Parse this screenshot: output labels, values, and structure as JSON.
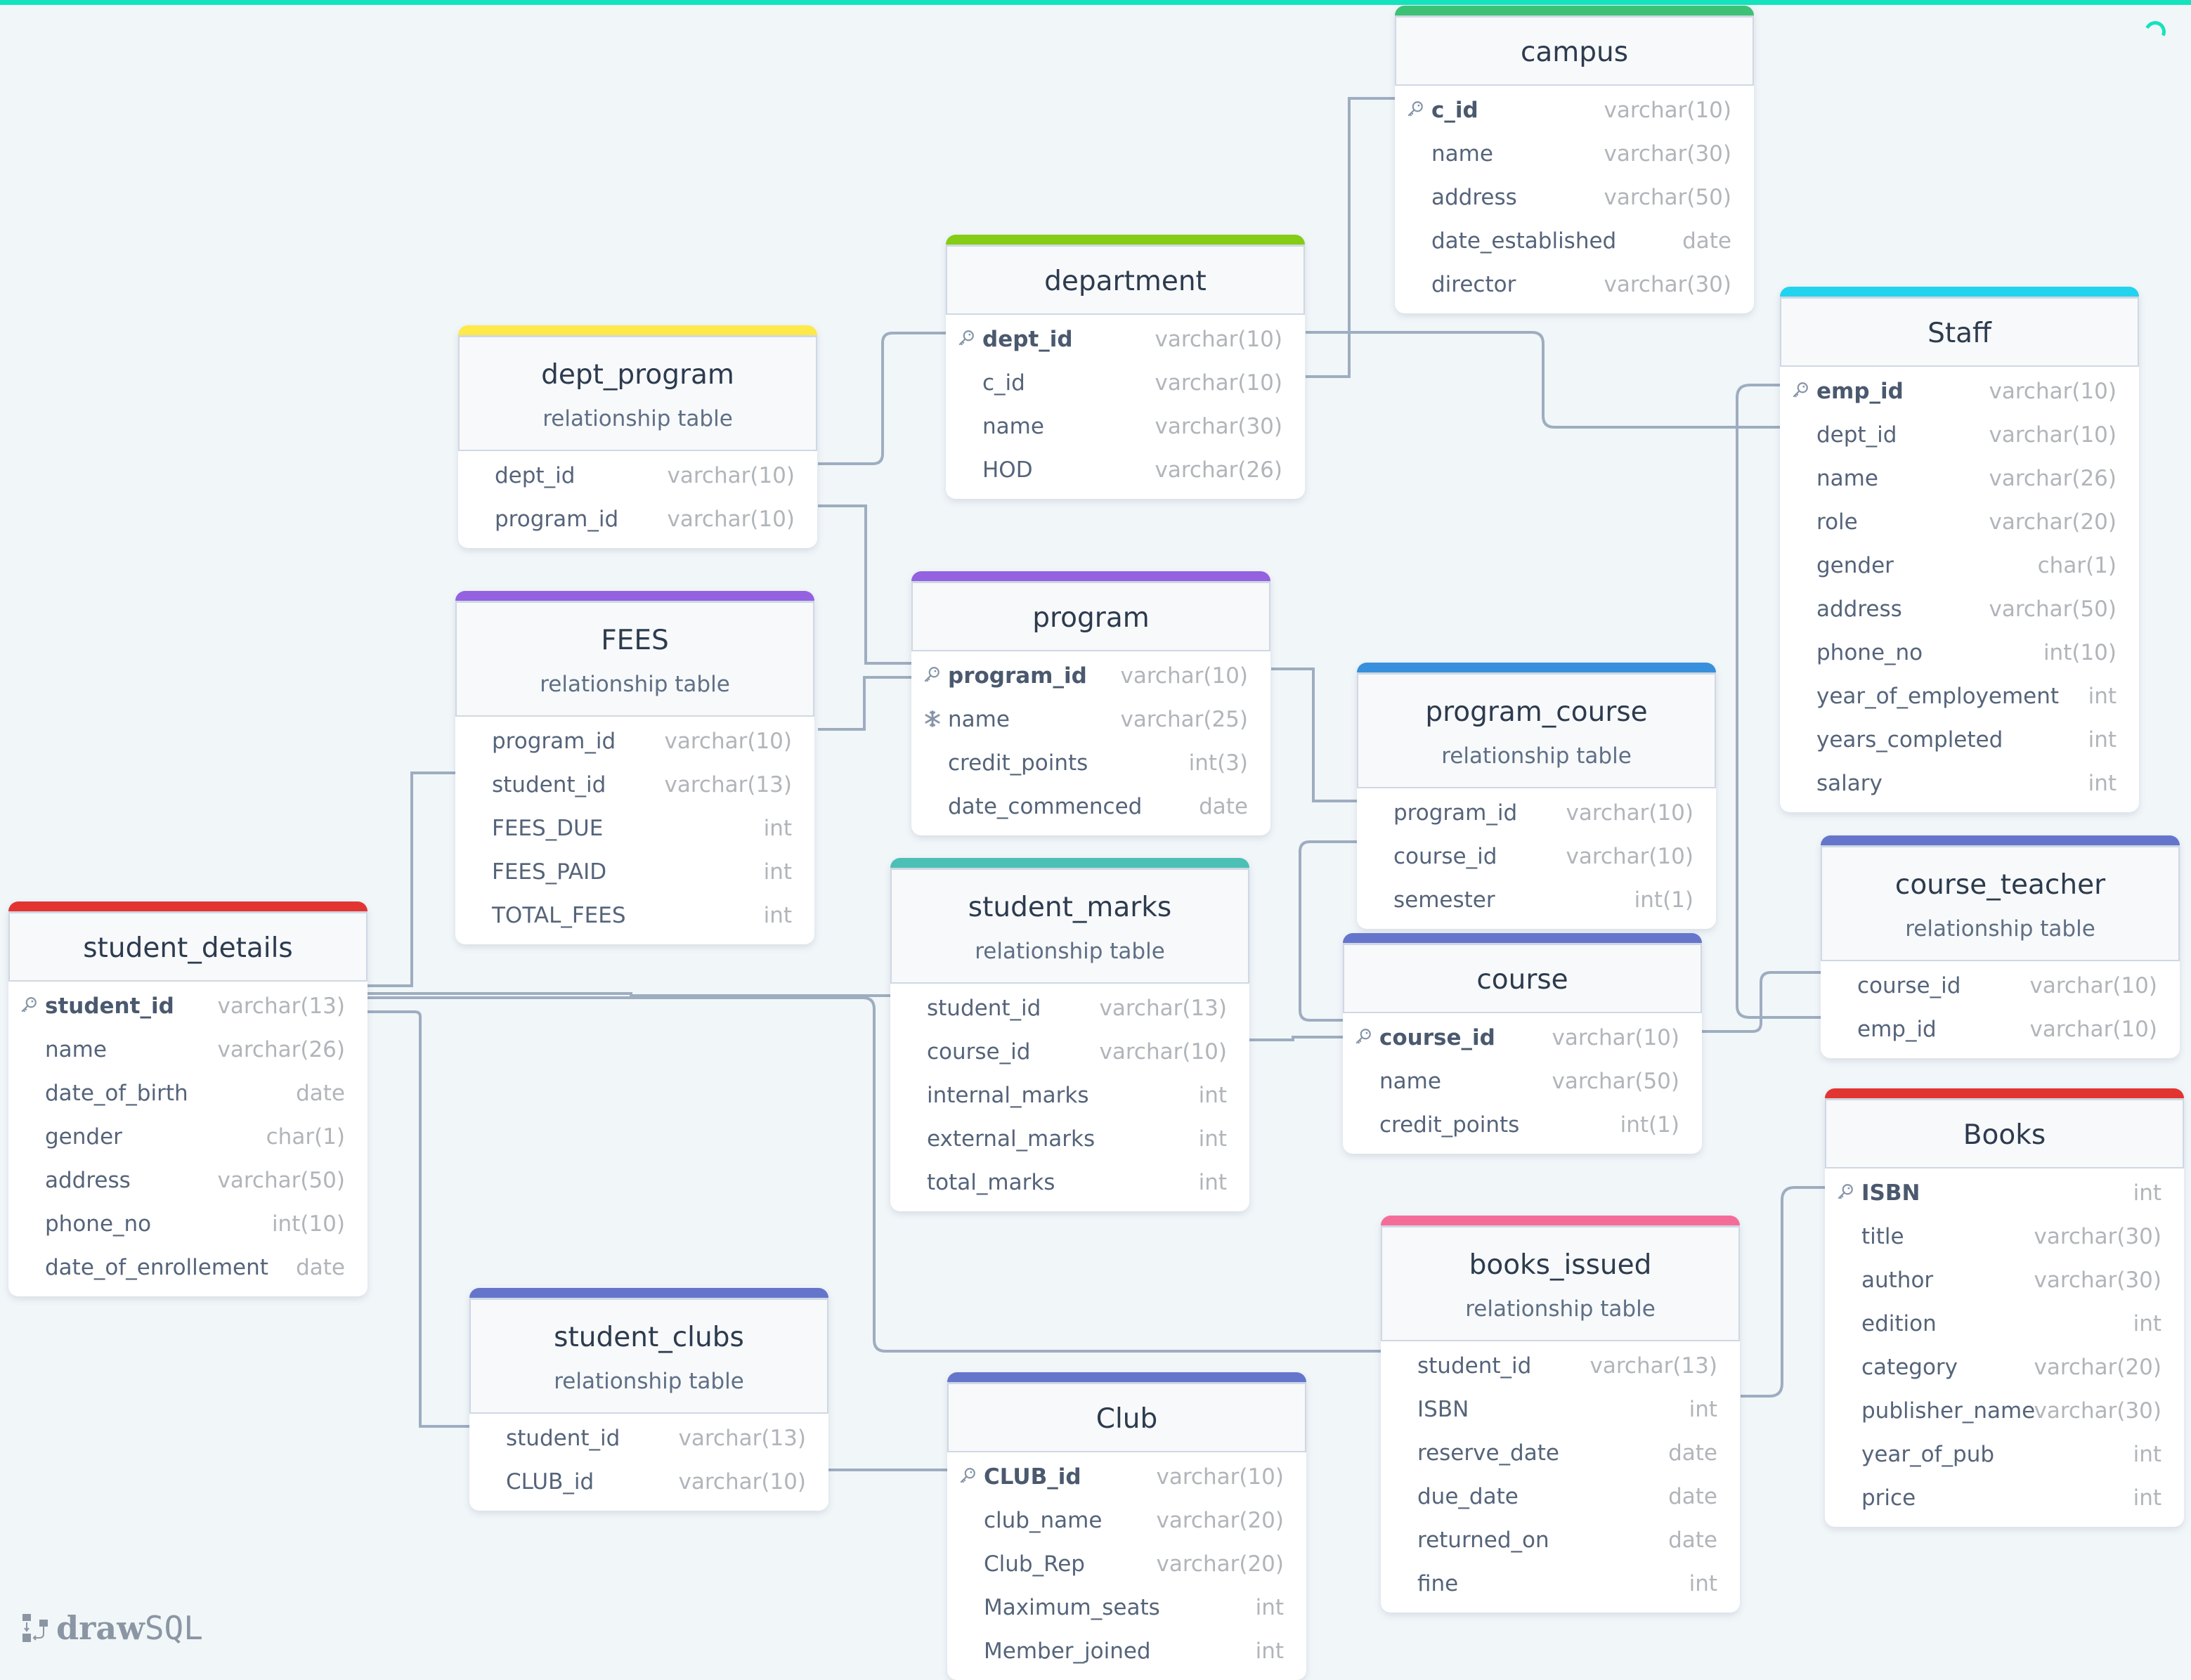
{
  "app": {
    "logo_text_bold": "draw",
    "logo_text_light": "SQL"
  },
  "colors": {
    "accent": "#14e3bd",
    "link": "#9eadc0"
  },
  "tables": {
    "campus": {
      "name": "campus",
      "color": "#3cc177",
      "fields": [
        {
          "name": "c_id",
          "type": "varchar(10)",
          "pk": true
        },
        {
          "name": "name",
          "type": "varchar(30)"
        },
        {
          "name": "address",
          "type": "varchar(50)"
        },
        {
          "name": "date_established",
          "type": "date"
        },
        {
          "name": "director",
          "type": "varchar(30)"
        }
      ]
    },
    "department": {
      "name": "department",
      "color": "#84cc16",
      "fields": [
        {
          "name": "dept_id",
          "type": "varchar(10)",
          "pk": true
        },
        {
          "name": "c_id",
          "type": "varchar(10)"
        },
        {
          "name": "name",
          "type": "varchar(30)"
        },
        {
          "name": "HOD",
          "type": "varchar(26)"
        }
      ]
    },
    "dept_program": {
      "name": "dept_program",
      "subtitle": "relationship table",
      "color": "#fde947",
      "fields": [
        {
          "name": "dept_id",
          "type": "varchar(10)"
        },
        {
          "name": "program_id",
          "type": "varchar(10)"
        }
      ]
    },
    "FEES": {
      "name": "FEES",
      "subtitle": "relationship table",
      "color": "#9461e0",
      "fields": [
        {
          "name": "program_id",
          "type": "varchar(10)"
        },
        {
          "name": "student_id",
          "type": "varchar(13)"
        },
        {
          "name": "FEES_DUE",
          "type": "int"
        },
        {
          "name": "FEES_PAID",
          "type": "int"
        },
        {
          "name": "TOTAL_FEES",
          "type": "int"
        }
      ]
    },
    "program": {
      "name": "program",
      "color": "#9461e0",
      "fields": [
        {
          "name": "program_id",
          "type": "varchar(10)",
          "pk": true
        },
        {
          "name": "name",
          "type": "varchar(25)",
          "unique": true
        },
        {
          "name": "credit_points",
          "type": "int(3)"
        },
        {
          "name": "date_commenced",
          "type": "date"
        }
      ]
    },
    "program_course": {
      "name": "program_course",
      "subtitle": "relationship table",
      "color": "#3890dc",
      "fields": [
        {
          "name": "program_id",
          "type": "varchar(10)"
        },
        {
          "name": "course_id",
          "type": "varchar(10)"
        },
        {
          "name": "semester",
          "type": "int(1)"
        }
      ]
    },
    "Staff": {
      "name": "Staff",
      "color": "#22d3ee",
      "fields": [
        {
          "name": "emp_id",
          "type": "varchar(10)",
          "pk": true
        },
        {
          "name": "dept_id",
          "type": "varchar(10)"
        },
        {
          "name": "name",
          "type": "varchar(26)"
        },
        {
          "name": "role",
          "type": "varchar(20)"
        },
        {
          "name": "gender",
          "type": "char(1)"
        },
        {
          "name": "address",
          "type": "varchar(50)"
        },
        {
          "name": "phone_no",
          "type": "int(10)"
        },
        {
          "name": "year_of_employement",
          "type": "int"
        },
        {
          "name": "years_completed",
          "type": "int"
        },
        {
          "name": "salary",
          "type": "int"
        }
      ]
    },
    "course_teacher": {
      "name": "course_teacher",
      "subtitle": "relationship table",
      "color": "#6675cc",
      "fields": [
        {
          "name": "course_id",
          "type": "varchar(10)"
        },
        {
          "name": "emp_id",
          "type": "varchar(10)"
        }
      ]
    },
    "course": {
      "name": "course",
      "color": "#6675cc",
      "fields": [
        {
          "name": "course_id",
          "type": "varchar(10)",
          "pk": true
        },
        {
          "name": "name",
          "type": "varchar(50)"
        },
        {
          "name": "credit_points",
          "type": "int(1)"
        }
      ]
    },
    "student_marks": {
      "name": "student_marks",
      "subtitle": "relationship table",
      "color": "#4cc0b5",
      "fields": [
        {
          "name": "student_id",
          "type": "varchar(13)"
        },
        {
          "name": "course_id",
          "type": "varchar(10)"
        },
        {
          "name": "internal_marks",
          "type": "int"
        },
        {
          "name": "external_marks",
          "type": "int"
        },
        {
          "name": "total_marks",
          "type": "int"
        }
      ]
    },
    "student_details": {
      "name": "student_details",
      "color": "#e23532",
      "fields": [
        {
          "name": "student_id",
          "type": "varchar(13)",
          "pk": true
        },
        {
          "name": "name",
          "type": "varchar(26)"
        },
        {
          "name": "date_of_birth",
          "type": "date"
        },
        {
          "name": "gender",
          "type": "char(1)"
        },
        {
          "name": "address",
          "type": "varchar(50)"
        },
        {
          "name": "phone_no",
          "type": "int(10)"
        },
        {
          "name": "date_of_enrollement",
          "type": "date"
        }
      ]
    },
    "student_clubs": {
      "name": "student_clubs",
      "subtitle": "relationship table",
      "color": "#6675cc",
      "fields": [
        {
          "name": "student_id",
          "type": "varchar(13)"
        },
        {
          "name": "CLUB_id",
          "type": "varchar(10)"
        }
      ]
    },
    "Club": {
      "name": "Club",
      "color": "#6675cc",
      "fields": [
        {
          "name": "CLUB_id",
          "type": "varchar(10)",
          "pk": true
        },
        {
          "name": "club_name",
          "type": "varchar(20)"
        },
        {
          "name": "Club_Rep",
          "type": "varchar(20)"
        },
        {
          "name": "Maximum_seats",
          "type": "int"
        },
        {
          "name": "Member_joined",
          "type": "int"
        }
      ]
    },
    "books_issued": {
      "name": "books_issued",
      "subtitle": "relationship table",
      "color": "#f46d99",
      "fields": [
        {
          "name": "student_id",
          "type": "varchar(13)"
        },
        {
          "name": "ISBN",
          "type": "int"
        },
        {
          "name": "reserve_date",
          "type": "date"
        },
        {
          "name": "due_date",
          "type": "date"
        },
        {
          "name": "returned_on",
          "type": "date"
        },
        {
          "name": "fine",
          "type": "int"
        }
      ]
    },
    "Books": {
      "name": "Books",
      "color": "#e23532",
      "fields": [
        {
          "name": "ISBN",
          "type": "int",
          "pk": true
        },
        {
          "name": "title",
          "type": "varchar(30)"
        },
        {
          "name": "author",
          "type": "varchar(30)"
        },
        {
          "name": "edition",
          "type": "int"
        },
        {
          "name": "category",
          "type": "varchar(20)"
        },
        {
          "name": "publisher_name",
          "type": "varchar(30)"
        },
        {
          "name": "year_of_pub",
          "type": "int"
        },
        {
          "name": "price",
          "type": "int"
        }
      ]
    }
  },
  "relationships": [
    {
      "from": "department.c_id",
      "to": "campus.c_id"
    },
    {
      "from": "dept_program.dept_id",
      "to": "department.dept_id"
    },
    {
      "from": "dept_program.program_id",
      "to": "program.program_id"
    },
    {
      "from": "FEES.program_id",
      "to": "program.program_id"
    },
    {
      "from": "FEES.student_id",
      "to": "student_details.student_id"
    },
    {
      "from": "Staff.dept_id",
      "to": "department.dept_id"
    },
    {
      "from": "program_course.program_id",
      "to": "program.program_id"
    },
    {
      "from": "program_course.course_id",
      "to": "course.course_id"
    },
    {
      "from": "course_teacher.course_id",
      "to": "course.course_id"
    },
    {
      "from": "course_teacher.emp_id",
      "to": "Staff.emp_id"
    },
    {
      "from": "student_marks.student_id",
      "to": "student_details.student_id"
    },
    {
      "from": "student_marks.course_id",
      "to": "course.course_id"
    },
    {
      "from": "student_clubs.student_id",
      "to": "student_details.student_id"
    },
    {
      "from": "student_clubs.CLUB_id",
      "to": "Club.CLUB_id"
    },
    {
      "from": "books_issued.student_id",
      "to": "student_details.student_id"
    },
    {
      "from": "books_issued.ISBN",
      "to": "Books.ISBN"
    }
  ]
}
